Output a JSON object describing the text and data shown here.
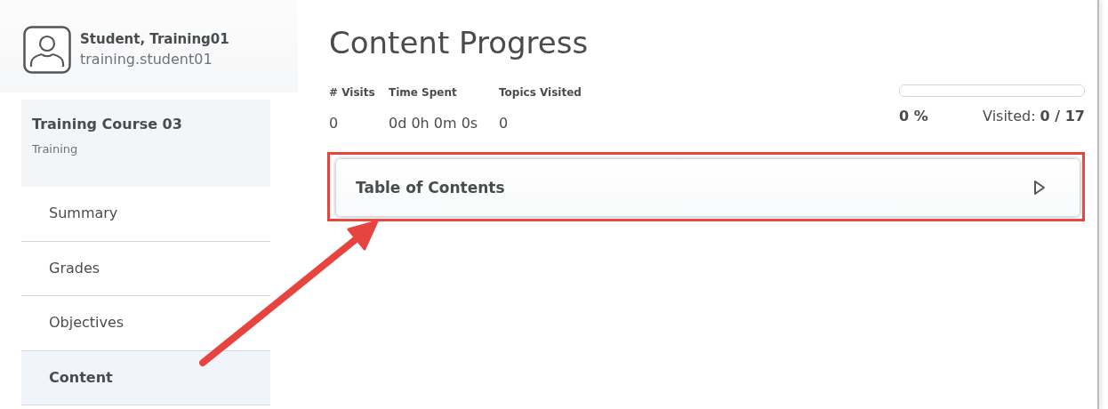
{
  "user": {
    "name": "Student, Training01",
    "username": "training.student01"
  },
  "course": {
    "title": "Training Course 03",
    "subtitle": "Training"
  },
  "nav": [
    {
      "label": "Summary",
      "selected": false
    },
    {
      "label": "Grades",
      "selected": false
    },
    {
      "label": "Objectives",
      "selected": false
    },
    {
      "label": "Content",
      "selected": true
    }
  ],
  "page_title": "Content Progress",
  "stats": [
    {
      "label": "# Visits",
      "value": "0"
    },
    {
      "label": "Time Spent",
      "value": "0d 0h 0m 0s"
    },
    {
      "label": "Topics Visited",
      "value": "0"
    }
  ],
  "progress": {
    "level": 0,
    "percent": "0 %",
    "visited": "Visited: **0 / 17**"
  },
  "toc": {
    "title": "Table of Contents",
    "expanded": false
  }
}
